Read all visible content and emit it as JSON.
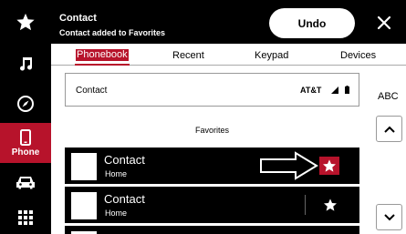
{
  "rail": {
    "items": [
      {
        "id": "favorites",
        "icon": "star-icon",
        "active": false
      },
      {
        "id": "music",
        "icon": "music-note-icon",
        "active": false
      },
      {
        "id": "navigation",
        "icon": "compass-icon",
        "active": false
      },
      {
        "id": "phone",
        "icon": "phone-icon",
        "label": "Phone",
        "active": true
      },
      {
        "id": "vehicle",
        "icon": "car-icon",
        "active": false
      },
      {
        "id": "apps",
        "icon": "grid-icon",
        "active": false
      }
    ]
  },
  "banner": {
    "title": "Contact",
    "message": "Contact added to Favorites",
    "undo_label": "Undo",
    "close_icon": "close-icon"
  },
  "tabs": [
    {
      "label": "Phonebook",
      "active": true
    },
    {
      "label": "Recent",
      "active": false
    },
    {
      "label": "Keypad",
      "active": false
    },
    {
      "label": "Devices",
      "active": false
    }
  ],
  "contact_bar": {
    "name": "Contact",
    "carrier": "AT&T",
    "signal_icon": "signal-icon",
    "battery_icon": "battery-icon"
  },
  "index_label": "ABC",
  "section_title": "Favorites",
  "favorites": [
    {
      "name": "Contact",
      "type": "Home",
      "favorited": true
    },
    {
      "name": "Contact",
      "type": "Home",
      "favorited": false
    }
  ],
  "colors": {
    "accent": "#b7132b",
    "background": "#000000",
    "surface": "#ffffff"
  }
}
